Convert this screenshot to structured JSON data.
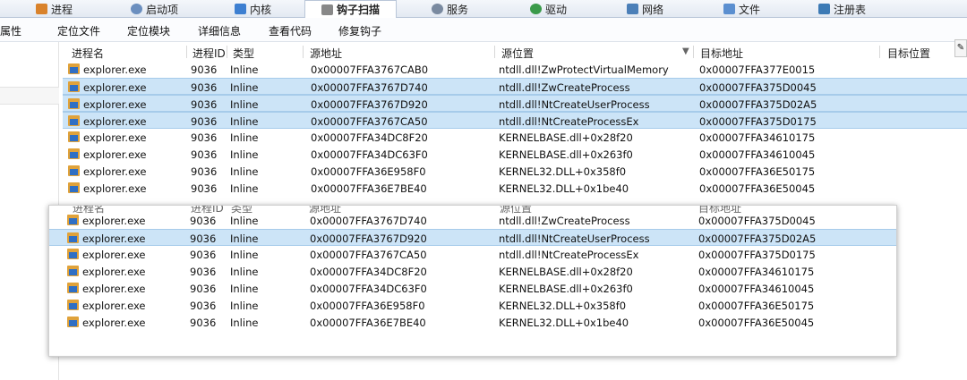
{
  "tabs": [
    {
      "label": "进程",
      "icon": "process-icon",
      "color": "#d9822b",
      "active": false
    },
    {
      "label": "启动项",
      "icon": "startup-icon",
      "color": "#6b8fbf",
      "active": false
    },
    {
      "label": "内核",
      "icon": "kernel-icon",
      "color": "#3d7fd1",
      "active": false
    },
    {
      "label": "钩子扫描",
      "icon": "hook-icon",
      "color": "#888888",
      "active": true
    },
    {
      "label": "服务",
      "icon": "service-icon",
      "color": "#7a8aa0",
      "active": false
    },
    {
      "label": "驱动",
      "icon": "driver-icon",
      "color": "#3a9a4a",
      "active": false
    },
    {
      "label": "网络",
      "icon": "network-icon",
      "color": "#4b7fb8",
      "active": false
    },
    {
      "label": "文件",
      "icon": "file-icon",
      "color": "#5b8fd0",
      "active": false
    },
    {
      "label": "注册表",
      "icon": "registry-icon",
      "color": "#3c7ab5",
      "active": false
    }
  ],
  "toolbar": {
    "left_label": "属性",
    "buttons": [
      "定位文件",
      "定位模块",
      "详细信息",
      "查看代码",
      "修复钩子"
    ]
  },
  "columns": [
    "进程名",
    "进程ID",
    "类型",
    "源地址",
    "源位置",
    "目标地址",
    "目标位置"
  ],
  "main_rows": [
    {
      "name": "explorer.exe",
      "pid": "9036",
      "type": "Inline",
      "src_addr": "0x00007FFA3767CAB0",
      "src_loc": "ntdll.dll!ZwProtectVirtualMemory",
      "dst_addr": "0x00007FFA377E0015",
      "selected": false
    },
    {
      "name": "explorer.exe",
      "pid": "9036",
      "type": "Inline",
      "src_addr": "0x00007FFA3767D740",
      "src_loc": "ntdll.dll!ZwCreateProcess",
      "dst_addr": "0x00007FFA375D0045",
      "selected": true
    },
    {
      "name": "explorer.exe",
      "pid": "9036",
      "type": "Inline",
      "src_addr": "0x00007FFA3767D920",
      "src_loc": "ntdll.dll!NtCreateUserProcess",
      "dst_addr": "0x00007FFA375D02A5",
      "selected": true
    },
    {
      "name": "explorer.exe",
      "pid": "9036",
      "type": "Inline",
      "src_addr": "0x00007FFA3767CA50",
      "src_loc": "ntdll.dll!NtCreateProcessEx",
      "dst_addr": "0x00007FFA375D0175",
      "selected": true
    },
    {
      "name": "explorer.exe",
      "pid": "9036",
      "type": "Inline",
      "src_addr": "0x00007FFA34DC8F20",
      "src_loc": "KERNELBASE.dll+0x28f20",
      "dst_addr": "0x00007FFA34610175",
      "selected": false
    },
    {
      "name": "explorer.exe",
      "pid": "9036",
      "type": "Inline",
      "src_addr": "0x00007FFA34DC63F0",
      "src_loc": "KERNELBASE.dll+0x263f0",
      "dst_addr": "0x00007FFA34610045",
      "selected": false
    },
    {
      "name": "explorer.exe",
      "pid": "9036",
      "type": "Inline",
      "src_addr": "0x00007FFA36E958F0",
      "src_loc": "KERNEL32.DLL+0x358f0",
      "dst_addr": "0x00007FFA36E50175",
      "selected": false
    },
    {
      "name": "explorer.exe",
      "pid": "9036",
      "type": "Inline",
      "src_addr": "0x00007FFA36E7BE40",
      "src_loc": "KERNEL32.DLL+0x1be40",
      "dst_addr": "0x00007FFA36E50045",
      "selected": false
    }
  ],
  "popup_rows": [
    {
      "name": "explorer.exe",
      "pid": "9036",
      "type": "Inline",
      "src_addr": "0x00007FFA3767D740",
      "src_loc": "ntdll.dll!ZwCreateProcess",
      "dst_addr": "0x00007FFA375D0045",
      "selected": false
    },
    {
      "name": "explorer.exe",
      "pid": "9036",
      "type": "Inline",
      "src_addr": "0x00007FFA3767D920",
      "src_loc": "ntdll.dll!NtCreateUserProcess",
      "dst_addr": "0x00007FFA375D02A5",
      "selected": true
    },
    {
      "name": "explorer.exe",
      "pid": "9036",
      "type": "Inline",
      "src_addr": "0x00007FFA3767CA50",
      "src_loc": "ntdll.dll!NtCreateProcessEx",
      "dst_addr": "0x00007FFA375D0175",
      "selected": false
    },
    {
      "name": "explorer.exe",
      "pid": "9036",
      "type": "Inline",
      "src_addr": "0x00007FFA34DC8F20",
      "src_loc": "KERNELBASE.dll+0x28f20",
      "dst_addr": "0x00007FFA34610175",
      "selected": false
    },
    {
      "name": "explorer.exe",
      "pid": "9036",
      "type": "Inline",
      "src_addr": "0x00007FFA34DC63F0",
      "src_loc": "KERNELBASE.dll+0x263f0",
      "dst_addr": "0x00007FFA34610045",
      "selected": false
    },
    {
      "name": "explorer.exe",
      "pid": "9036",
      "type": "Inline",
      "src_addr": "0x00007FFA36E958F0",
      "src_loc": "KERNEL32.DLL+0x358f0",
      "dst_addr": "0x00007FFA36E50175",
      "selected": false
    },
    {
      "name": "explorer.exe",
      "pid": "9036",
      "type": "Inline",
      "src_addr": "0x00007FFA36E7BE40",
      "src_loc": "KERNEL32.DLL+0x1be40",
      "dst_addr": "0x00007FFA36E50045",
      "selected": false
    }
  ],
  "colors": {
    "selection": "#cce4f7",
    "selection_border": "#a6cbea"
  }
}
